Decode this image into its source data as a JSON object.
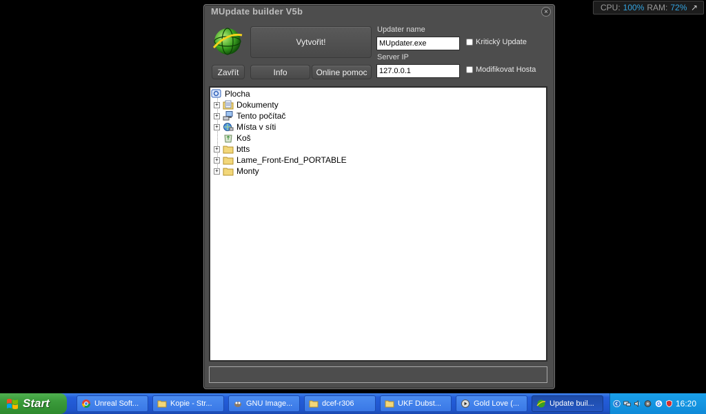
{
  "sysmon": {
    "cpu_label": "CPU:",
    "cpu_value": "100%",
    "ram_label": "RAM:",
    "ram_value": "72%",
    "arrow": "↗"
  },
  "window": {
    "title": "MUpdate builder V5b",
    "close_glyph": "×",
    "buttons": {
      "create": "Vytvořit!",
      "close": "Zavřít",
      "info": "Info",
      "help": "Online pomoc"
    },
    "updater_name_label": "Updater name",
    "updater_name_value": "MUpdater.exe",
    "server_ip_label": "Server IP",
    "server_ip_value": "127.0.0.1",
    "chk_critical": "Kritický Update",
    "chk_host": "Modifikovat Hosta"
  },
  "tree": {
    "root": "Plocha",
    "items": [
      {
        "label": "Dokumenty",
        "icon": "documents-icon",
        "expand": "+"
      },
      {
        "label": "Tento počítač",
        "icon": "computer-icon",
        "expand": "+"
      },
      {
        "label": "Místa v síti",
        "icon": "network-icon",
        "expand": "+"
      },
      {
        "label": "Koš",
        "icon": "recycle-bin-icon",
        "expand": ""
      },
      {
        "label": "btts",
        "icon": "folder-icon",
        "expand": "+"
      },
      {
        "label": "Lame_Front-End_PORTABLE",
        "icon": "folder-icon",
        "expand": "+"
      },
      {
        "label": "Monty",
        "icon": "folder-icon",
        "expand": "+"
      }
    ]
  },
  "taskbar": {
    "start": "Start",
    "tasks": [
      {
        "label": "Unreal Soft...",
        "icon": "chrome-icon"
      },
      {
        "label": "Kopie - Str...",
        "icon": "folder-icon"
      },
      {
        "label": "GNU Image...",
        "icon": "gimp-icon"
      },
      {
        "label": "dcef-r306",
        "icon": "folder-icon"
      },
      {
        "label": "UKF Dubst...",
        "icon": "folder-icon"
      },
      {
        "label": "Gold Love (...",
        "icon": "media-icon"
      },
      {
        "label": "Update buil...",
        "icon": "globe-icon"
      }
    ],
    "clock": "16:20"
  }
}
